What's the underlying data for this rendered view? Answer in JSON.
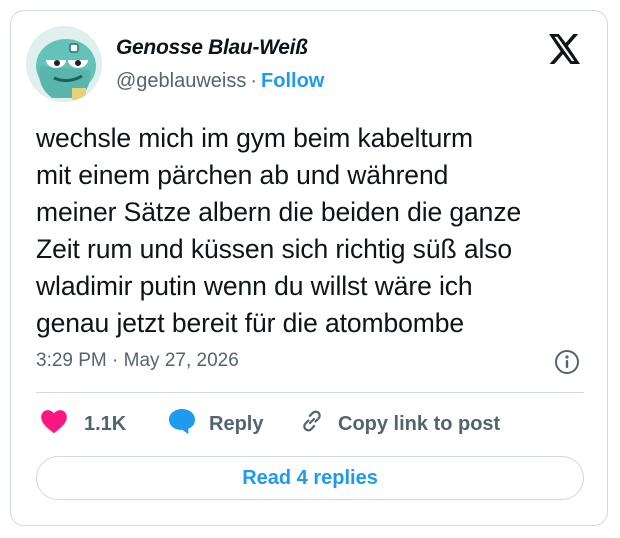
{
  "author": {
    "display_name": "Genosse Blau-Weiß",
    "handle": "@geblauweiss",
    "separator": "·",
    "follow_label": "Follow"
  },
  "icons": {
    "brand": "x-logo-icon",
    "info": "info-icon",
    "like": "heart-icon",
    "reply": "speech-bubble-icon",
    "copy": "link-icon"
  },
  "post": {
    "text": "wechsle mich im gym beim kabelturm\nmit einem pärchen ab und während\nmeiner Sätze albern die beiden die ganze\nZeit rum und küssen sich richtig süß also\nwladimir putin wenn du willst wäre ich\ngenau jetzt bereit für die atombombe",
    "time": "3:29 PM",
    "separator": "·",
    "date": "May 27, 2026"
  },
  "actions": {
    "like_count": "1.1K",
    "reply_label": "Reply",
    "copy_label": "Copy link to post"
  },
  "read_replies_label": "Read 4 replies",
  "colors": {
    "accent": "#1d9bf0",
    "like": "#f91880",
    "muted": "#536471",
    "text": "#0f1419",
    "border": "#cfd9de"
  }
}
